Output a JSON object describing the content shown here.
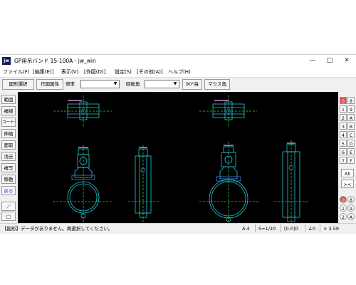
{
  "window": {
    "logo": "jw",
    "title": "GP用吊バンド 15-100A - jw_win",
    "min_glyph": "—",
    "max_glyph": "□",
    "close_glyph": "✕"
  },
  "menu": [
    "ファイル(F)",
    "[編集(E)]",
    "表示(V)",
    "[作図(D)]",
    "設定(S)",
    "[その他(A)]",
    "ヘルプ(H)"
  ],
  "toolbar": {
    "select_figure": "図形選択",
    "figure_attr": "作図属性",
    "scale_label": "倍率",
    "rotation_label": "回転角",
    "deg90": "90°毎",
    "mouse_angle": "マウス角",
    "dropdown_glyph": "▼"
  },
  "left_tools": [
    "範囲",
    "複線",
    "コーナー",
    "伸縮",
    "面取",
    "消去",
    "複写",
    "移動",
    "戻る"
  ],
  "left_shapes": {
    "line_glyph": "／",
    "rect_glyph": "□",
    "circle_glyph": "○"
  },
  "right_tools": {
    "layers_left": [
      "0",
      "1",
      "2",
      "3",
      "4",
      "5",
      "6",
      "7"
    ],
    "layers_right": [
      "8",
      "9",
      "A",
      "B",
      "C",
      "D",
      "E",
      "F"
    ],
    "all_label": "All",
    "toggle_glyph": "><",
    "groups_left": [
      "0",
      "1",
      "2"
    ],
    "groups_right": [
      "8",
      "9",
      "A"
    ]
  },
  "status": {
    "message": "【図形】データがありません。再選択してください。",
    "paper": "A-4",
    "scale": "S=1/20",
    "layer": "[0-0]0",
    "angle": "∠0",
    "zoom": "× 3.59"
  },
  "colors": {
    "canvas": "#000000",
    "drawing": "#22c9d1",
    "center_line": "#2fcf3c",
    "bolt": "#4a7be8",
    "active_layer": "#e14b4b",
    "undo": "#1a3fd0",
    "label_magenta": "#d37ad6"
  }
}
